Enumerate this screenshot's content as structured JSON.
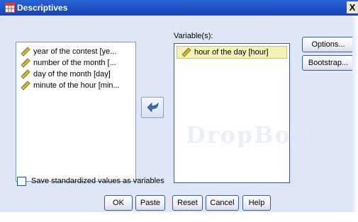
{
  "window": {
    "title": "Descriptives",
    "close_symbol": "X",
    "icon": "table-icon"
  },
  "source_list": {
    "items": [
      {
        "label": "year of the contest [ye...",
        "icon": "scale-ruler-icon"
      },
      {
        "label": "number of the month [...",
        "icon": "scale-ruler-icon"
      },
      {
        "label": "day of the month [day]",
        "icon": "scale-ruler-icon"
      },
      {
        "label": "minute of the hour [min...",
        "icon": "scale-ruler-icon"
      }
    ]
  },
  "move_button": {
    "icon": "arrow-left-icon",
    "color": "#3f6fb4"
  },
  "target_list": {
    "label": "Variable(s):",
    "items": [
      {
        "label": "hour of the day [hour]",
        "icon": "scale-ruler-icon"
      }
    ]
  },
  "side_buttons": {
    "options": "Options...",
    "bootstrap": "Bootstrap..."
  },
  "checkbox": {
    "label": "Save standardized values as variables",
    "checked": false
  },
  "buttons": {
    "ok": "OK",
    "paste": "Paste",
    "reset": "Reset",
    "cancel": "Cancel",
    "help": "Help"
  },
  "watermark": {
    "text": "DropBook"
  },
  "colors": {
    "titlebar": "#1c4fc2",
    "dialog_bg": "#dfe7f7",
    "selected_item_bg": "#f5f2b8"
  }
}
